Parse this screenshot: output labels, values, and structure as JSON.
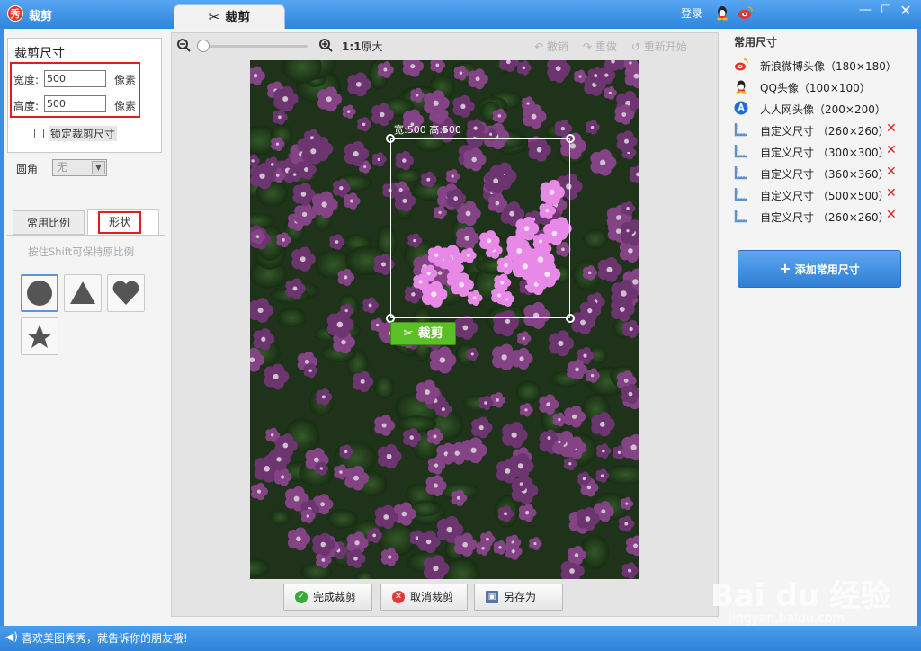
{
  "window": {
    "title": "裁剪",
    "tab": "裁剪",
    "login": "登录"
  },
  "left": {
    "size_title": "裁剪尺寸",
    "width_label": "宽度:",
    "width_value": "500",
    "height_label": "高度:",
    "height_value": "500",
    "unit": "像素",
    "lock_label": "锁定裁剪尺寸",
    "corner_label": "圆角",
    "corner_value": "无",
    "tabs": [
      "常用比例",
      "形状"
    ],
    "hint": "按住Shift可保持原比例",
    "shapes": [
      "circle-icon",
      "triangle-icon",
      "heart-icon",
      "star-icon"
    ],
    "selected_shape": "circle-icon"
  },
  "toolbar": {
    "zoom_1to1": "1:1",
    "original": "原大",
    "undo": "撤销",
    "redo": "重做",
    "restart": "重新开始"
  },
  "canvas": {
    "size_tip": "宽:500 高:500",
    "crop_button": "裁剪"
  },
  "bottom": {
    "finish": "完成裁剪",
    "cancel": "取消裁剪",
    "save_as": "另存为"
  },
  "presets": {
    "title": "常用尺寸",
    "items": [
      {
        "label": "新浪微博头像（180×180）",
        "icon": "weibo-icon",
        "deletable": false
      },
      {
        "label": "QQ头像（100×100）",
        "icon": "qq-icon",
        "deletable": false
      },
      {
        "label": "人人网头像（200×200）",
        "icon": "renren-icon",
        "deletable": false
      },
      {
        "label": "自定义尺寸 （260×260）",
        "icon": "ruler-icon",
        "deletable": true
      },
      {
        "label": "自定义尺寸 （300×300）",
        "icon": "ruler-icon",
        "deletable": true
      },
      {
        "label": "自定义尺寸 （360×360）",
        "icon": "ruler-icon",
        "deletable": true
      },
      {
        "label": "自定义尺寸 （500×500）",
        "icon": "ruler-icon",
        "deletable": true
      },
      {
        "label": "自定义尺寸 （260×260）",
        "icon": "ruler-icon",
        "deletable": true
      }
    ],
    "add_button": "添加常用尺寸"
  },
  "status": {
    "text": "喜欢美图秀秀，就告诉你的朋友哦!"
  },
  "watermark": {
    "brand": "Bai du 经验",
    "url": "jingyan.baidu.com"
  },
  "colors": {
    "accent": "#2f86dc",
    "highlight": "#e11d1d",
    "crop_green": "#5bbf27"
  }
}
